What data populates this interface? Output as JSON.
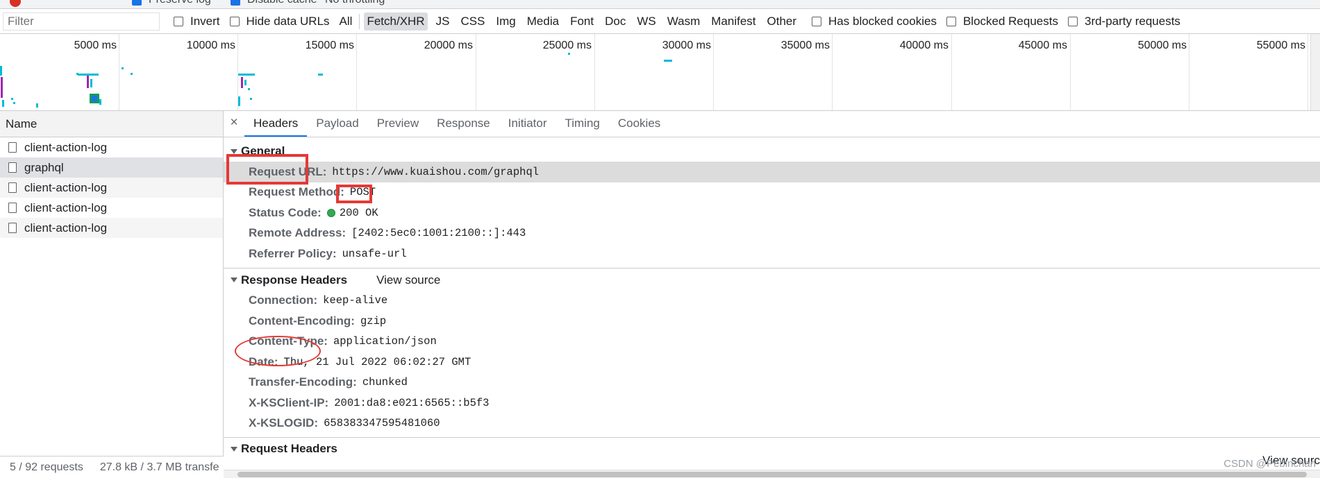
{
  "toolbar": {
    "preserve_log": "Preserve log",
    "disable_cache": "Disable cache",
    "throttling": "No throttling"
  },
  "filter_bar": {
    "filter_placeholder": "Filter",
    "invert": "Invert",
    "hide_data_urls": "Hide data URLs",
    "types": [
      "All",
      "Fetch/XHR",
      "JS",
      "CSS",
      "Img",
      "Media",
      "Font",
      "Doc",
      "WS",
      "Wasm",
      "Manifest",
      "Other"
    ],
    "active_type": "Fetch/XHR",
    "has_blocked_cookies": "Has blocked cookies",
    "blocked_requests": "Blocked Requests",
    "third_party": "3rd-party requests"
  },
  "overview": {
    "ticks": [
      "5000 ms",
      "10000 ms",
      "15000 ms",
      "20000 ms",
      "25000 ms",
      "30000 ms",
      "35000 ms",
      "40000 ms",
      "45000 ms",
      "50000 ms",
      "55000 ms"
    ]
  },
  "request_list": {
    "header": "Name",
    "rows": [
      "client-action-log",
      "graphql",
      "client-action-log",
      "client-action-log",
      "client-action-log"
    ],
    "selected_index": 1
  },
  "status_bar": {
    "requests": "5 / 92 requests",
    "transferred": "27.8 kB / 3.7 MB transfe"
  },
  "detail": {
    "close": "×",
    "tabs": [
      "Headers",
      "Payload",
      "Preview",
      "Response",
      "Initiator",
      "Timing",
      "Cookies"
    ],
    "active_tab": "Headers",
    "general": {
      "title": "General",
      "rows": [
        {
          "k": "Request URL:",
          "v": "https://www.kuaishou.com/graphql"
        },
        {
          "k": "Request Method:",
          "v": "POST"
        },
        {
          "k": "Status Code:",
          "v": "200 OK"
        },
        {
          "k": "Remote Address:",
          "v": "[2402:5ec0:1001:2100::]:443"
        },
        {
          "k": "Referrer Policy:",
          "v": "unsafe-url"
        }
      ]
    },
    "response_headers": {
      "title": "Response Headers",
      "view_source": "View source",
      "rows": [
        {
          "k": "Connection:",
          "v": "keep-alive"
        },
        {
          "k": "Content-Encoding:",
          "v": "gzip"
        },
        {
          "k": "Content-Type:",
          "v": "application/json"
        },
        {
          "k": "Date:",
          "v": "Thu, 21 Jul 2022 06:02:27 GMT"
        },
        {
          "k": "Transfer-Encoding:",
          "v": "chunked"
        },
        {
          "k": "X-KSClient-IP:",
          "v": "2001:da8:e021:6565::b5f3"
        },
        {
          "k": "X-KSLOGID:",
          "v": "658383347595481060"
        }
      ]
    },
    "request_headers": {
      "title": "Request Headers",
      "view_source": "View sourc"
    }
  },
  "watermark": "CSDN @Pebinchan",
  "colors": {
    "accent": "#1a73e8",
    "status_ok": "#34a853",
    "annotation": "#e53935"
  }
}
